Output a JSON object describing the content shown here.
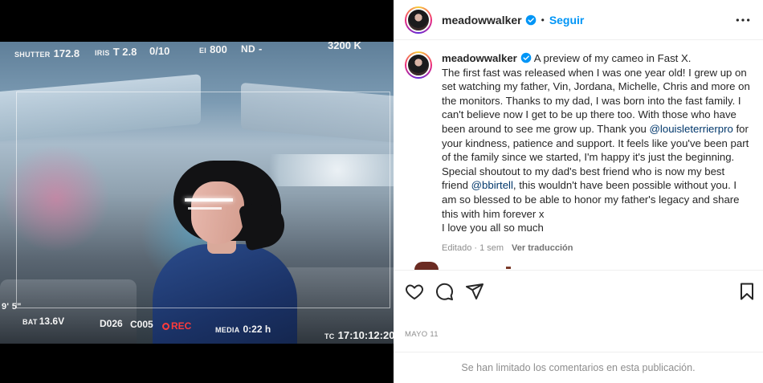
{
  "media": {
    "hud": {
      "shutter_label": "SHUTTER",
      "shutter_value": "172.8",
      "iris_label": "IRIS",
      "iris_value": "T 2.8",
      "frame_counter": "0/10",
      "ei_label": "EI",
      "ei_value": "800",
      "nd_label": "ND",
      "nd_value": "-",
      "wb_value": "3200 K",
      "focus_marks": "9'  5\"",
      "bat_label": "BAT",
      "bat_value": "13.6V",
      "clip_d": "D026",
      "clip_c": "C005",
      "rec_label": "REC",
      "media_label": "MEDIA",
      "media_value": "0:22 h",
      "tc_label": "TC",
      "tc_value": "17:10:12:20"
    }
  },
  "post": {
    "username": "meadowwalker",
    "follow_label": "Seguir",
    "separator": "•",
    "caption_lines": [
      " A preview of my cameo in Fast X.",
      "The first fast was released when I was one year old! I grew up on set watching my father, Vin, Jordana, Michelle, Chris and more on the monitors. Thanks to my dad, I was born into the fast family. I can't believe now I get to be up there too. With those who have been around to see me grow up. Thank you "
    ],
    "mention_1": "@louisleterrierpro",
    "caption_mid": " for your kindness, patience and support. It feels like you've been part of the family since we started, I'm happy it's just the beginning. Special shoutout to my dad's best friend who is now my best friend ",
    "mention_2": "@bbirtell",
    "caption_end": ", this wouldn't have been possible without you. I am so blessed to be able to honor my father's legacy and share this with him forever x",
    "caption_last": "I love you all so much",
    "edited": "Editado",
    "age": " · 1 sem",
    "translate": "Ver traducción",
    "date": "MAYO 11",
    "comments_limited": "Se han limitado los comentarios en esta publicación."
  },
  "icons": {
    "like": "heart-icon",
    "comment": "comment-icon",
    "share": "paper-plane-icon",
    "save": "bookmark-icon",
    "more": "more-icon",
    "verified": "verified-badge-icon"
  },
  "colors": {
    "accent": "#0095f6",
    "mention": "#00376b",
    "muted": "#8e8e8e",
    "rec": "#ff3b3b"
  }
}
